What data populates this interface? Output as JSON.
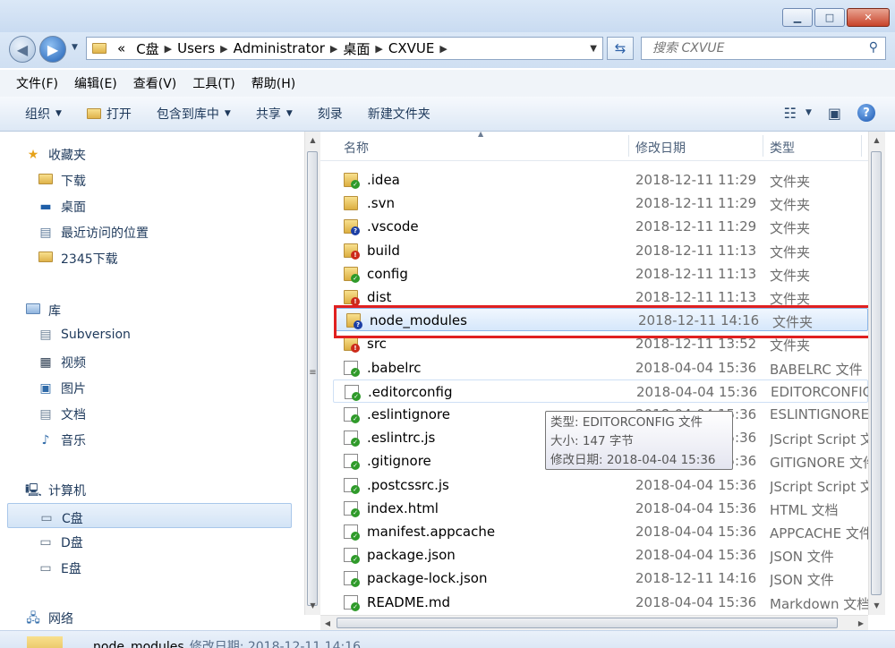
{
  "window": {
    "minimize": "▁",
    "maximize": "□",
    "close": "✕"
  },
  "address": {
    "overflow": "«",
    "crumbs": [
      "C盘",
      "Users",
      "Administrator",
      "桌面",
      "CXVUE"
    ],
    "search_placeholder": "搜索 CXVUE"
  },
  "menu": [
    "文件(F)",
    "编辑(E)",
    "查看(V)",
    "工具(T)",
    "帮助(H)"
  ],
  "toolbar": {
    "organize": "组织",
    "open": "打开",
    "include_in_library": "包含到库中",
    "share": "共享",
    "burn": "刻录",
    "new_folder": "新建文件夹"
  },
  "nav": {
    "favorites": "收藏夹",
    "favorites_items": [
      "下载",
      "桌面",
      "最近访问的位置",
      "2345下载"
    ],
    "libraries": "库",
    "library_items": [
      "Subversion",
      "视频",
      "图片",
      "文档",
      "音乐"
    ],
    "computer": "计算机",
    "drives": [
      "C盘",
      "D盘",
      "E盘"
    ],
    "network": "网络"
  },
  "columns": {
    "name": "名称",
    "modified": "修改日期",
    "type": "类型"
  },
  "files": [
    {
      "name": ".idea",
      "date": "2018-12-11 11:29",
      "type": "文件夹",
      "kind": "folder",
      "status": "ok"
    },
    {
      "name": ".svn",
      "date": "2018-12-11 11:29",
      "type": "文件夹",
      "kind": "folder",
      "status": "none"
    },
    {
      "name": ".vscode",
      "date": "2018-12-11 11:29",
      "type": "文件夹",
      "kind": "folder",
      "status": "unversioned"
    },
    {
      "name": "build",
      "date": "2018-12-11 11:13",
      "type": "文件夹",
      "kind": "folder",
      "status": "modified"
    },
    {
      "name": "config",
      "date": "2018-12-11 11:13",
      "type": "文件夹",
      "kind": "folder",
      "status": "ok"
    },
    {
      "name": "dist",
      "date": "2018-12-11 11:13",
      "type": "文件夹",
      "kind": "folder",
      "status": "modified"
    },
    {
      "name": "node_modules",
      "date": "2018-12-11 14:16",
      "type": "文件夹",
      "kind": "folder",
      "status": "unversioned",
      "selected": true
    },
    {
      "name": "src",
      "date": "2018-12-11 13:52",
      "type": "文件夹",
      "kind": "folder",
      "status": "modified"
    },
    {
      "name": ".babelrc",
      "date": "2018-04-04 15:36",
      "type": "BABELRC 文件",
      "kind": "doc",
      "status": "ok"
    },
    {
      "name": ".editorconfig",
      "date": "2018-04-04 15:36",
      "type": "EDITORCONFIG",
      "kind": "doc",
      "status": "ok",
      "hover": true
    },
    {
      "name": ".eslintignore",
      "date": "2018-04-04 15:36",
      "type": "ESLINTIGNORE",
      "kind": "doc",
      "status": "ok"
    },
    {
      "name": ".eslintrc.js",
      "date": "2018-04-04 15:36",
      "type": "JScript Script 文",
      "kind": "script",
      "status": "ok"
    },
    {
      "name": ".gitignore",
      "date": "2018-04-04 15:36",
      "type": "GITIGNORE 文件",
      "kind": "doc",
      "status": "ok"
    },
    {
      "name": ".postcssrc.js",
      "date": "2018-04-04 15:36",
      "type": "JScript Script 文",
      "kind": "script",
      "status": "ok"
    },
    {
      "name": "index.html",
      "date": "2018-04-04 15:36",
      "type": "HTML 文档",
      "kind": "doc",
      "status": "ok"
    },
    {
      "name": "manifest.appcache",
      "date": "2018-04-04 15:36",
      "type": "APPCACHE 文件",
      "kind": "doc",
      "status": "ok"
    },
    {
      "name": "package.json",
      "date": "2018-04-04 15:36",
      "type": "JSON 文件",
      "kind": "edit",
      "status": "ok"
    },
    {
      "name": "package-lock.json",
      "date": "2018-12-11 14:16",
      "type": "JSON 文件",
      "kind": "edit",
      "status": "ok"
    },
    {
      "name": "README.md",
      "date": "2018-04-04 15:36",
      "type": "Markdown 文档",
      "kind": "doc",
      "status": "ok"
    }
  ],
  "tooltip": {
    "type_line": "类型: EDITORCONFIG 文件",
    "size_line": "大小: 147 字节",
    "date_line": "修改日期: 2018-04-04 15:36"
  },
  "details": {
    "name": "node_modules",
    "label": "修改日期: 2018-12-11 14:16"
  },
  "colors": {
    "selection_box": "#e02020",
    "status_ok": "#2f9a2a",
    "status_modified": "#cc2a1a",
    "status_unversioned": "#1c3fa5"
  }
}
